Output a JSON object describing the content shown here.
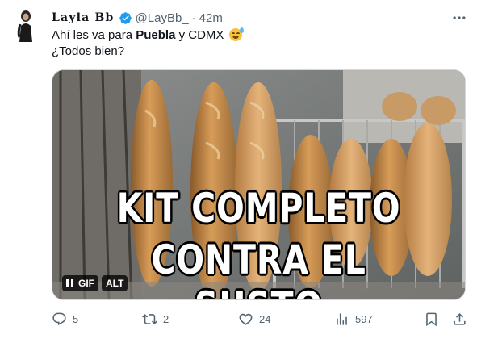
{
  "tweet": {
    "display_name": "Layla Bb",
    "handle": "@LayBb_",
    "separator": "·",
    "time": "42m",
    "text_line1_pre": "Ahí les va para ",
    "text_line1_bold": "Puebla",
    "text_line1_post": " y CDMX",
    "text_line2": "¿Todos bien?",
    "emoji_icon": "sweat-smile-emoji"
  },
  "media": {
    "caption_line1": "KIT COMPLETO",
    "caption_line2": "CONTRA EL SUSTO",
    "gif_label": "GIF",
    "alt_label": "ALT"
  },
  "actions": {
    "replies": "5",
    "reposts": "2",
    "likes": "24",
    "views": "597"
  },
  "colors": {
    "text": "#0f1419",
    "secondary": "#536471",
    "verified": "#1d9bf0"
  }
}
